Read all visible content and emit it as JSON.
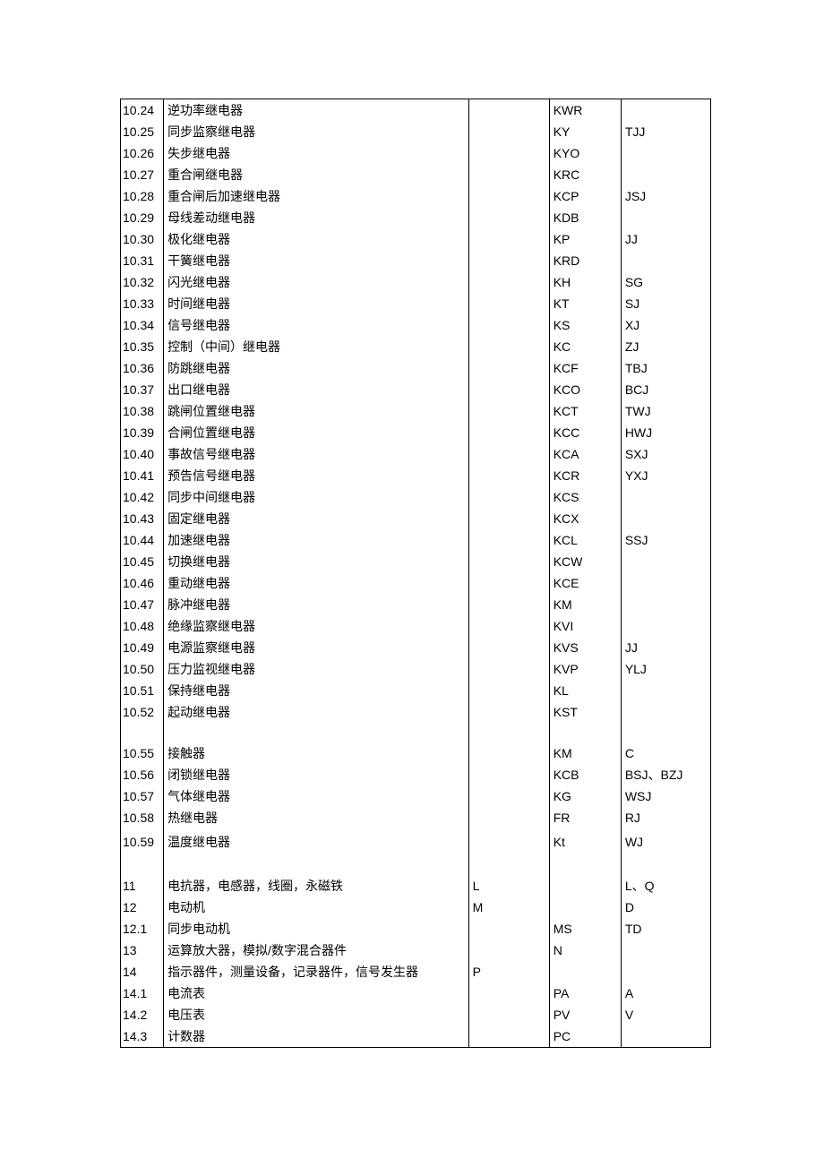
{
  "rows": [
    {
      "n": "10.24",
      "name": "逆功率继电器",
      "c": "",
      "d": "KWR",
      "e": ""
    },
    {
      "n": "10.25",
      "name": "同步监察继电器",
      "c": "",
      "d": "KY",
      "e": "TJJ"
    },
    {
      "n": "10.26",
      "name": "失步继电器",
      "c": "",
      "d": "KYO",
      "e": ""
    },
    {
      "n": "10.27",
      "name": "重合闸继电器",
      "c": "",
      "d": "KRC",
      "e": ""
    },
    {
      "n": "10.28",
      "name": "重合闸后加速继电器",
      "c": "",
      "d": "KCP",
      "e": "JSJ"
    },
    {
      "n": "10.29",
      "name": "母线差动继电器",
      "c": "",
      "d": "KDB",
      "e": ""
    },
    {
      "n": "10.30",
      "name": "极化继电器",
      "c": "",
      "d": "KP",
      "e": "JJ"
    },
    {
      "n": "10.31",
      "name": "干簧继电器",
      "c": "",
      "d": "KRD",
      "e": ""
    },
    {
      "n": "10.32",
      "name": "闪光继电器",
      "c": "",
      "d": "KH",
      "e": "SG"
    },
    {
      "n": "10.33",
      "name": "时间继电器",
      "c": "",
      "d": "KT",
      "e": "SJ"
    },
    {
      "n": "10.34",
      "name": "信号继电器",
      "c": "",
      "d": "KS",
      "e": "XJ"
    },
    {
      "n": "10.35",
      "name": "控制（中间）继电器",
      "c": "",
      "d": "KC",
      "e": "ZJ"
    },
    {
      "n": "10.36",
      "name": "防跳继电器",
      "c": "",
      "d": "KCF",
      "e": "TBJ"
    },
    {
      "n": "10.37",
      "name": "出口继电器",
      "c": "",
      "d": "KCO",
      "e": "BCJ"
    },
    {
      "n": "10.38",
      "name": "跳闸位置继电器",
      "c": "",
      "d": "KCT",
      "e": "TWJ"
    },
    {
      "n": "10.39",
      "name": "合闸位置继电器",
      "c": "",
      "d": "KCC",
      "e": "HWJ"
    },
    {
      "n": "10.40",
      "name": "事故信号继电器",
      "c": "",
      "d": "KCA",
      "e": "SXJ"
    },
    {
      "n": "10.41",
      "name": "预告信号继电器",
      "c": "",
      "d": "KCR",
      "e": "YXJ"
    },
    {
      "n": "10.42",
      "name": "同步中间继电器",
      "c": "",
      "d": "KCS",
      "e": ""
    },
    {
      "n": "10.43",
      "name": "固定继电器",
      "c": "",
      "d": "KCX",
      "e": ""
    },
    {
      "n": "10.44",
      "name": "加速继电器",
      "c": "",
      "d": "KCL",
      "e": "SSJ"
    },
    {
      "n": "10.45",
      "name": "切换继电器",
      "c": "",
      "d": "KCW",
      "e": ""
    },
    {
      "n": "10.46",
      "name": "重动继电器",
      "c": "",
      "d": "KCE",
      "e": ""
    },
    {
      "n": "10.47",
      "name": "脉冲继电器",
      "c": "",
      "d": "KM",
      "e": ""
    },
    {
      "n": "10.48",
      "name": "绝缘监察继电器",
      "c": "",
      "d": "KVI",
      "e": ""
    },
    {
      "n": "10.49",
      "name": "电源监察继电器",
      "c": "",
      "d": "KVS",
      "e": "JJ"
    },
    {
      "n": "10.50",
      "name": "压力监视继电器",
      "c": "",
      "d": "KVP",
      "e": "YLJ"
    },
    {
      "n": "10.51",
      "name": "保持继电器",
      "c": "",
      "d": "KL",
      "e": ""
    },
    {
      "n": "10.52",
      "name": "起动继电器",
      "c": "",
      "d": "KST",
      "e": ""
    },
    {
      "blank": true
    },
    {
      "n": "10.55",
      "name": "接触器",
      "c": "",
      "d": "KM",
      "e": "C"
    },
    {
      "n": "10.56",
      "name": "闭锁继电器",
      "c": "",
      "d": "KCB",
      "e": "BSJ、BZJ"
    },
    {
      "n": "10.57",
      "name": "气体继电器",
      "c": "",
      "d": "KG",
      "e": "WSJ"
    },
    {
      "n": "10.58",
      "name": "热继电器",
      "c": "",
      "d": "FR",
      "e": "RJ"
    },
    {
      "n": "10.59",
      "name": "温度继电器",
      "c": "",
      "d": "Kt",
      "e": "WJ",
      "tall": true
    },
    {
      "blank": true
    },
    {
      "n": "11",
      "name": "电抗器，电感器，线圈，永磁铁",
      "c": "L",
      "d": "",
      "e": "L、Q"
    },
    {
      "n": "12",
      "name": "电动机",
      "c": "M",
      "d": "",
      "e": "D"
    },
    {
      "n": "12.1",
      "name": "同步电动机",
      "c": "",
      "d": "MS",
      "e": "TD"
    },
    {
      "n": "13",
      "name": "运算放大器，模拟/数字混合器件",
      "c": "",
      "d": "N",
      "e": ""
    },
    {
      "n": "14",
      "name": "指示器件，测量设备，记录器件，信号发生器",
      "c": "P",
      "d": "",
      "e": ""
    },
    {
      "n": "14.1",
      "name": "电流表",
      "c": "",
      "d": "PA",
      "e": "A"
    },
    {
      "n": "14.2",
      "name": "电压表",
      "c": "",
      "d": "PV",
      "e": "V"
    },
    {
      "n": "14.3",
      "name": "计数器",
      "c": "",
      "d": "PC",
      "e": ""
    }
  ]
}
